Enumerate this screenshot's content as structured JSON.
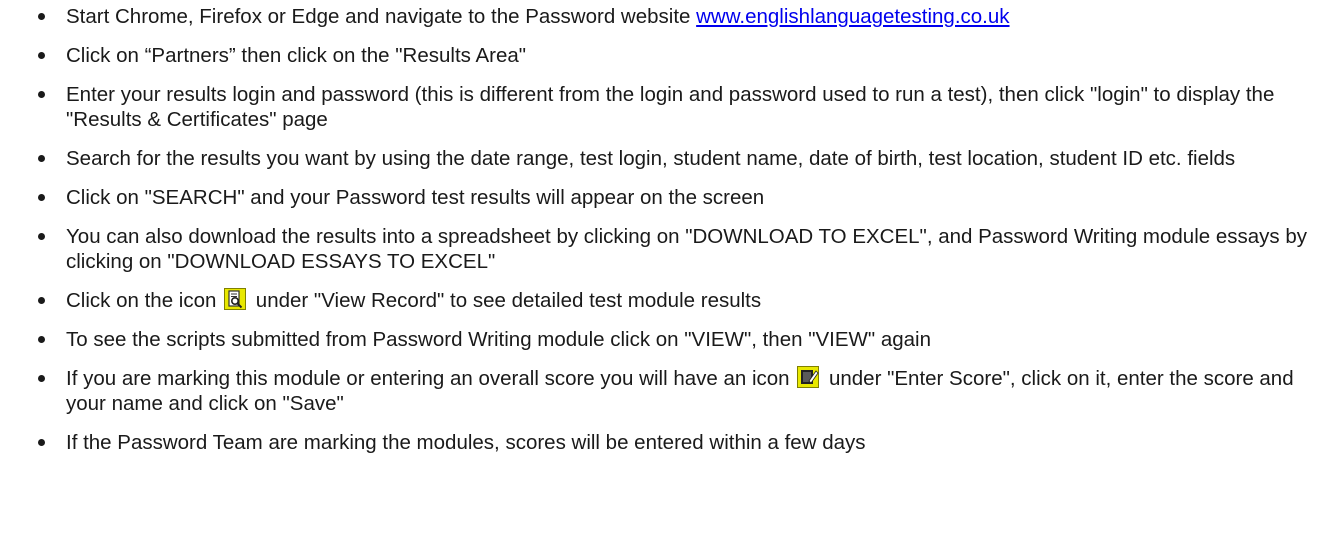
{
  "steps": [
    {
      "pre": "Start Chrome, Firefox or Edge and navigate to the Password website ",
      "link": "www.englishlanguagetesting.co.uk"
    },
    {
      "text": "Click on “Partners” then click on the \"Results Area\""
    },
    {
      "text": "Enter your results login and password (this is different from the login and password used to run a test), then click \"login\" to display the \"Results & Certificates\" page"
    },
    {
      "text": "Search for the results you want by using the date range, test login, student name, date of birth, test location, student ID etc. fields"
    },
    {
      "text": "Click on \"SEARCH\" and your Password test results will appear on the screen"
    },
    {
      "text": "You can also download the results into a spreadsheet by clicking on \"DOWNLOAD TO EXCEL\", and Password Writing module essays by clicking on \"DOWNLOAD ESSAYS TO EXCEL\""
    },
    {
      "pre": "Click on the icon ",
      "icon": "view-record-icon",
      "post": " under \"View Record\" to see detailed test module results"
    },
    {
      "text": "To see the scripts submitted from Password Writing module click on \"VIEW\", then \"VIEW\" again"
    },
    {
      "pre": "If you are marking this module or entering an overall score you will have an icon ",
      "icon": "enter-score-icon",
      "post": " under \"Enter Score\", click on it, enter the score and your name and click on \"Save\""
    },
    {
      "text": "If the Password Team are marking the modules, scores will be entered within a few days"
    }
  ],
  "colors": {
    "text": "#1a1a1a",
    "link": "#0000ee",
    "icon_background": "#e8e800",
    "icon_edge": "#808000"
  }
}
